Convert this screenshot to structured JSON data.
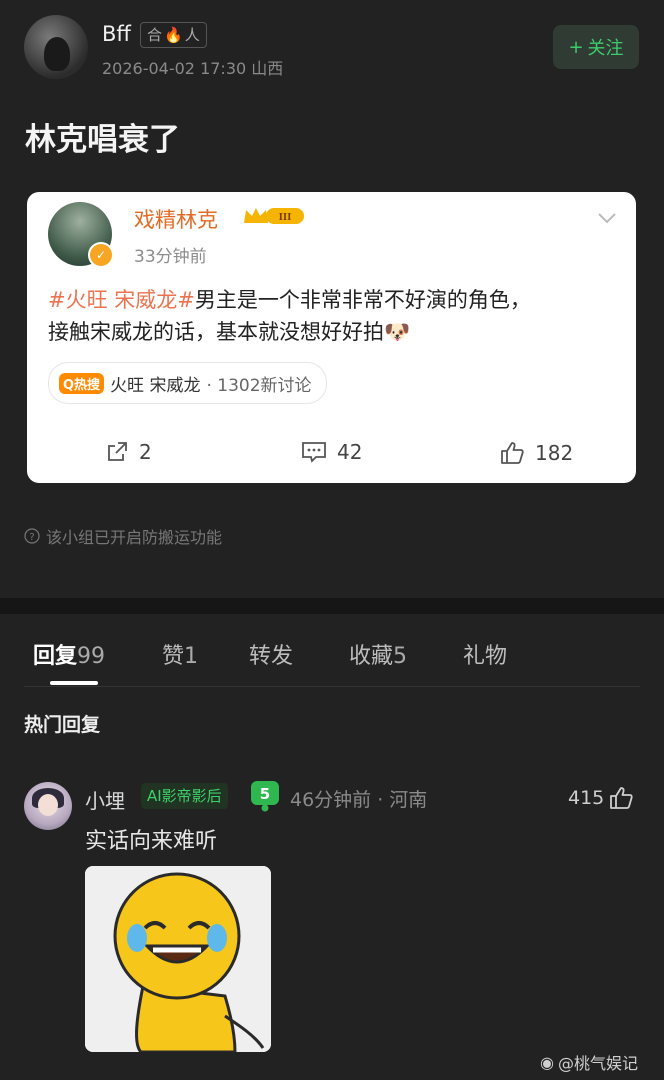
{
  "post": {
    "username": "Bff",
    "group_badge_left": "合",
    "group_badge_right": "人",
    "time": "2026-04-02 17:30",
    "location": "山西",
    "follow_label": "关注",
    "follow_plus": "+",
    "text": "林克唱衰了"
  },
  "quoted": {
    "name": "戏精林克",
    "level": "III",
    "time": "33分钟前",
    "hashtag": "#火旺 宋威龙#",
    "text_line1": "男主是一个非常非常不好演的角色，",
    "text_line2": "接触宋威龙的话，基本就没想好好拍",
    "topic_badge": "Q热搜",
    "topic_name": "火旺 宋威龙",
    "topic_count": "· 1302新讨论",
    "repost_count": "2",
    "comment_count": "42",
    "like_count": "182"
  },
  "notice": "该小组已开启防搬运功能",
  "tabs": {
    "reply_label": "回复",
    "reply_count": "99",
    "like_label": "赞",
    "like_count": "1",
    "forward_label": "转发",
    "fav_label": "收藏",
    "fav_count": "5",
    "gift_label": "礼物"
  },
  "hot_replies_title": "热门回复",
  "comment": {
    "name": "小埋",
    "badge": "AI影帝影后",
    "level": "5",
    "time": "46分钟前 · 河南",
    "like_count": "415",
    "text": "实话向来难听"
  },
  "watermark": "@桃气娱记",
  "colors": {
    "accent_green": "#3dcc6c",
    "topic_orange": "#eb7350",
    "name_orange": "#e36a24",
    "background": "#222222"
  }
}
